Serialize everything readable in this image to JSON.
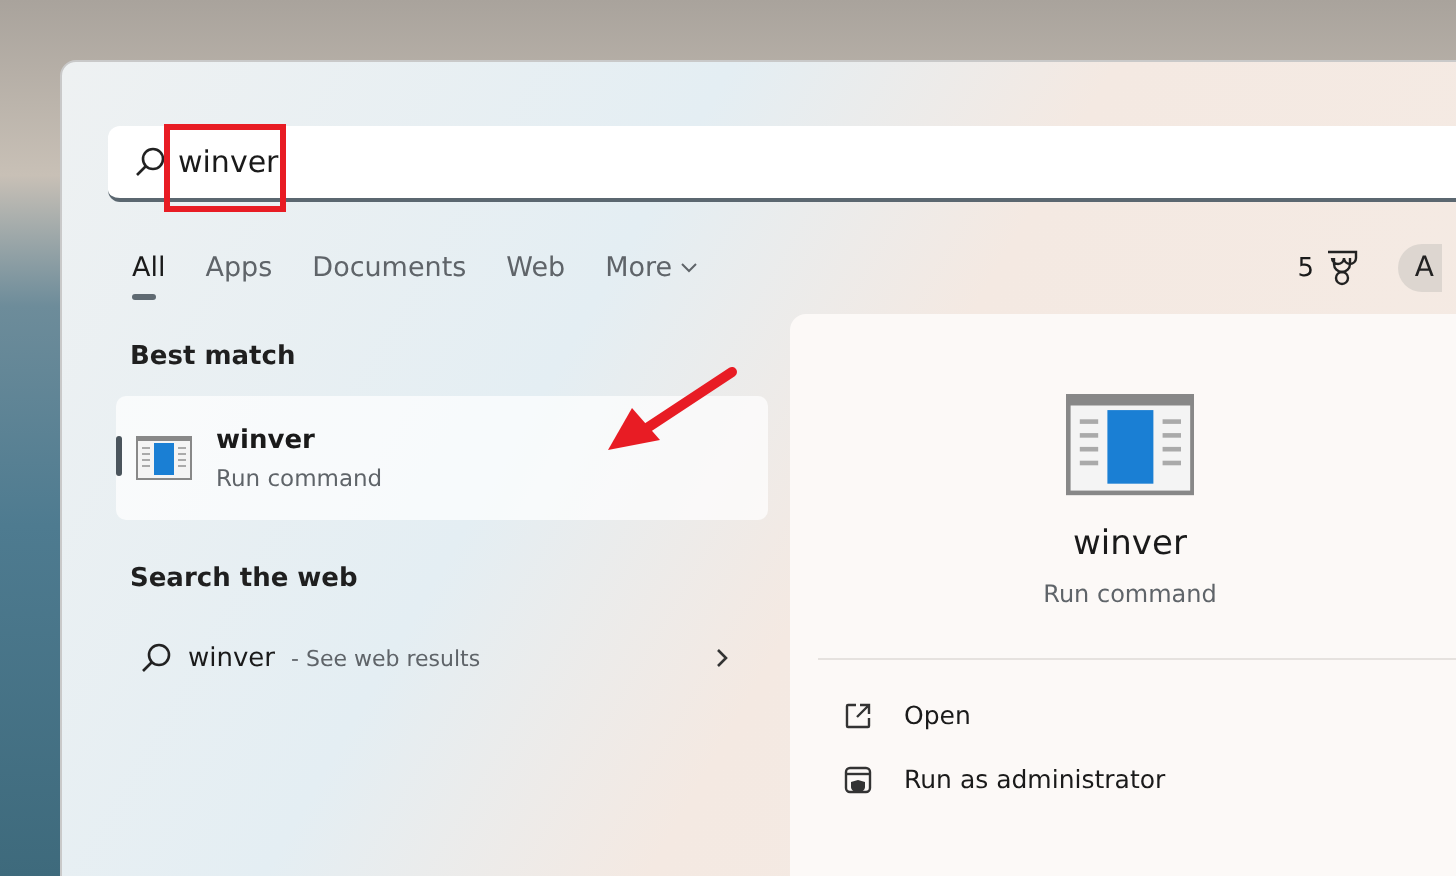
{
  "search": {
    "value": "winver"
  },
  "tabs": [
    {
      "label": "All",
      "selected": true
    },
    {
      "label": "Apps",
      "selected": false
    },
    {
      "label": "Documents",
      "selected": false
    },
    {
      "label": "Web",
      "selected": false
    },
    {
      "label": "More",
      "selected": false
    }
  ],
  "rewards": {
    "points": "5"
  },
  "account": {
    "initial": "A"
  },
  "best_match": {
    "heading": "Best match",
    "title": "winver",
    "subtitle": "Run command",
    "selected": true
  },
  "web": {
    "heading": "Search the web",
    "query": "winver",
    "suffix": "- See web results"
  },
  "details": {
    "title": "winver",
    "subtitle": "Run command",
    "actions": [
      {
        "kind": "open",
        "label": "Open"
      },
      {
        "kind": "admin",
        "label": "Run as administrator"
      }
    ]
  }
}
